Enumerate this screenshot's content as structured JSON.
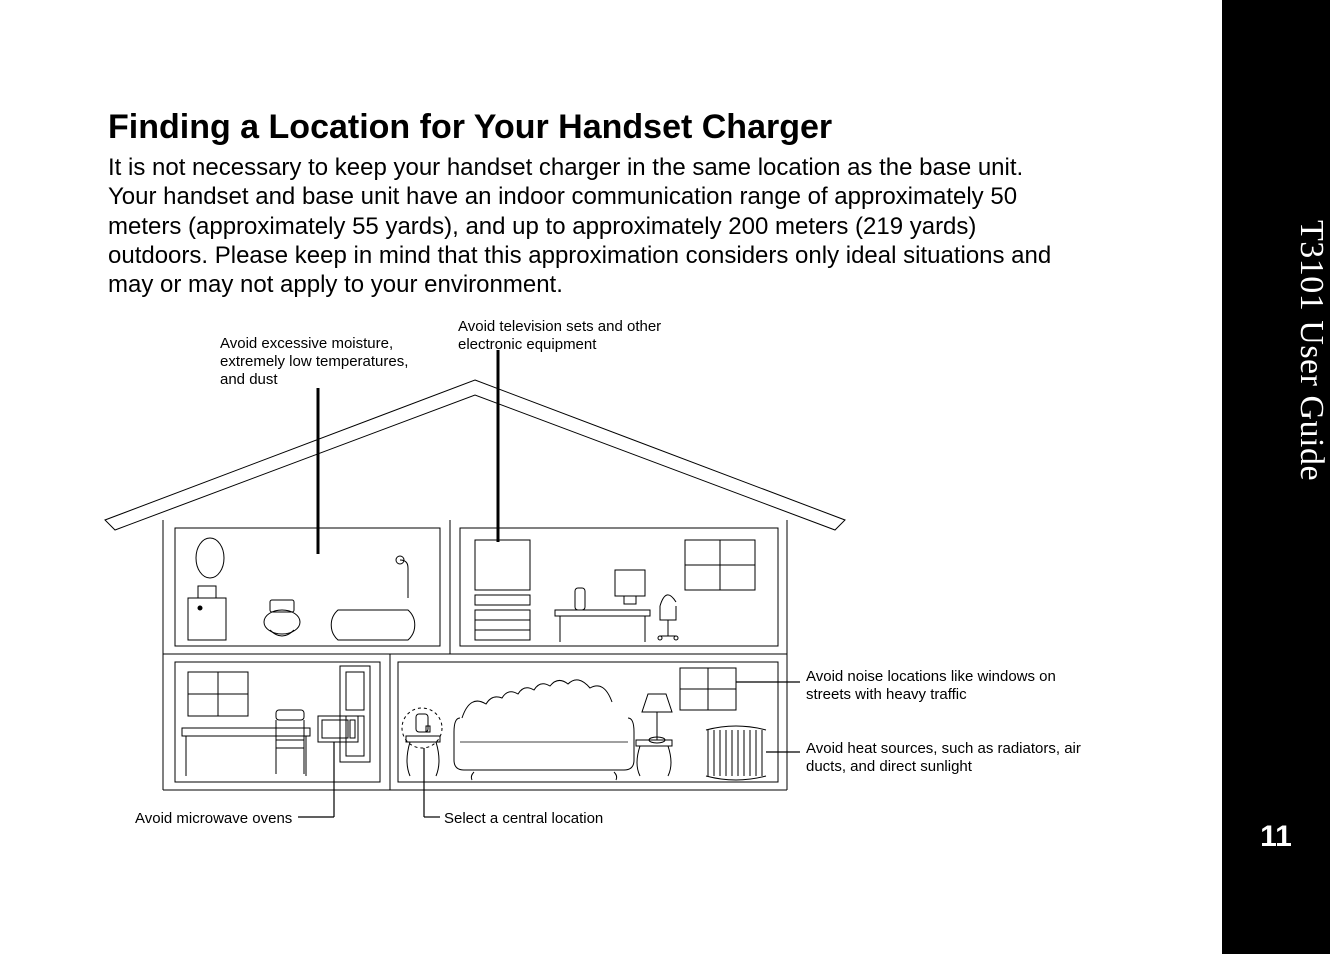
{
  "sidebar": {
    "title": "T3101 User Guide",
    "page_number": "11"
  },
  "section": {
    "heading": "Finding a Location for Your Handset Charger",
    "body": "It is not necessary to keep your handset charger in the same location as the base unit. Your handset and base unit have an indoor communication range of approximately 50 meters (approximately 55 yards), and up to approximately 200 meters (219 yards) outdoors. Please keep in mind that this approximation considers only ideal situations and may or may not apply to your environment."
  },
  "callouts": {
    "top_left": "Avoid excessive moisture, extremely low temperatures, and dust",
    "top_right": "Avoid television sets and other electronic equipment",
    "right_upper": "Avoid noise locations like windows on streets with heavy traffic",
    "right_lower": "Avoid heat sources, such as radiators, air ducts, and direct sunlight",
    "bottom_left": "Avoid microwave ovens",
    "bottom_center": "Select a central location"
  }
}
